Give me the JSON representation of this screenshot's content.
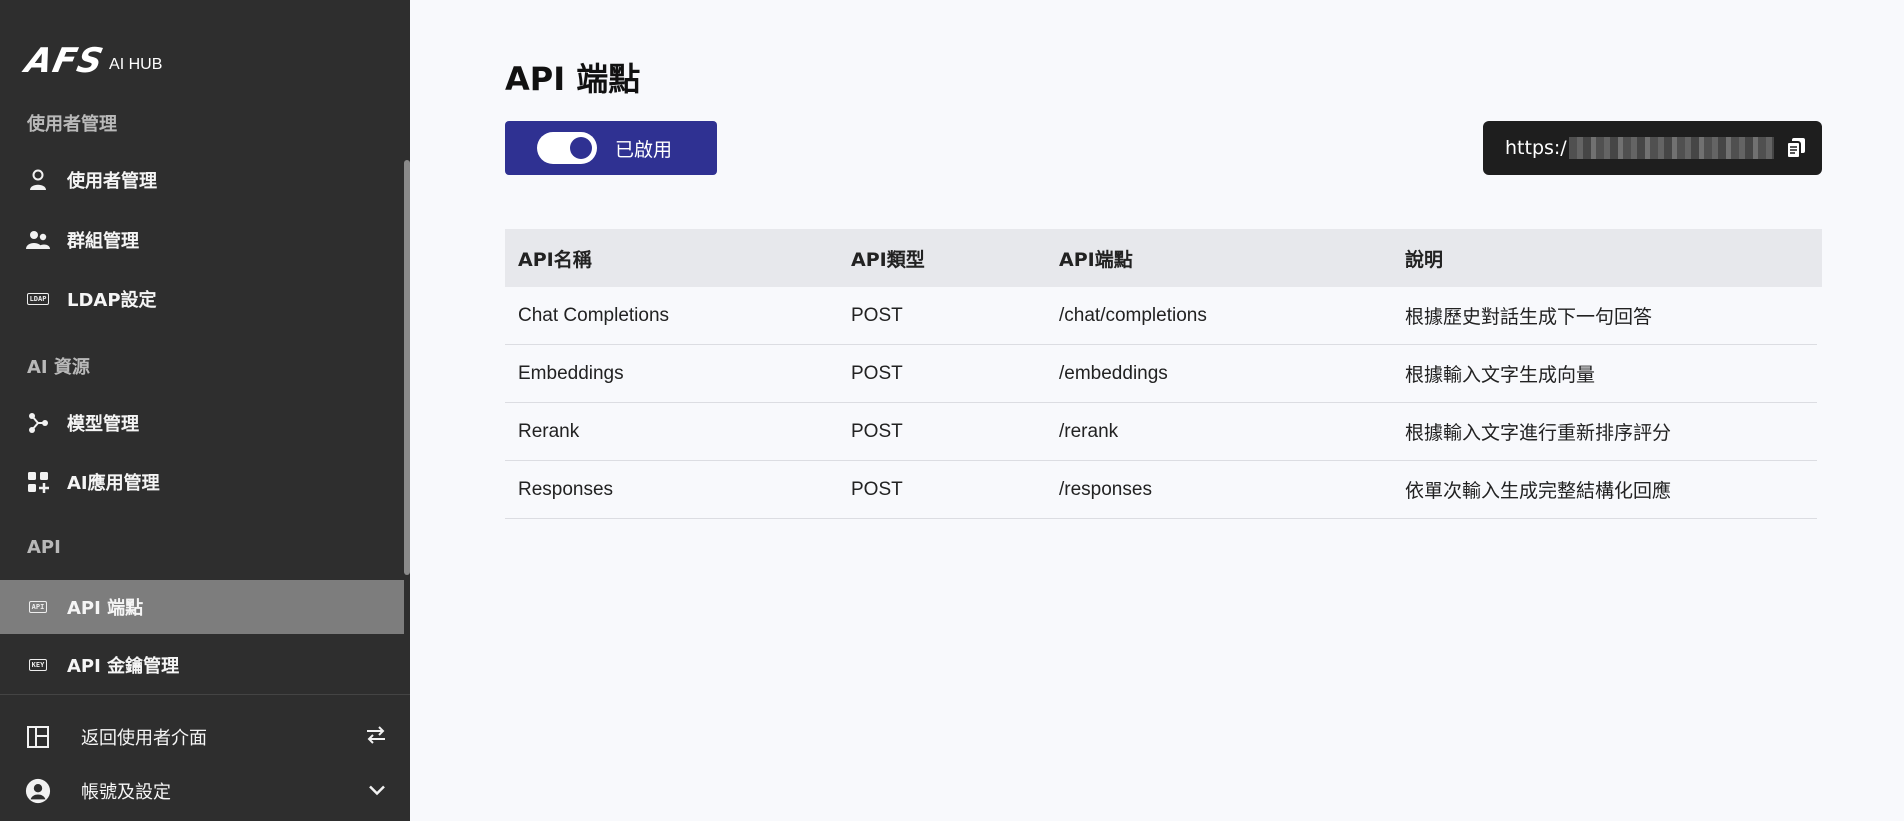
{
  "brand": {
    "mark": "AFS",
    "sub": "AI HUB"
  },
  "sidebar": {
    "sections": [
      {
        "label": "使用者管理"
      },
      {
        "label": "AI 資源"
      },
      {
        "label": "API"
      }
    ],
    "items": [
      {
        "label": "使用者管理",
        "icon": "user-icon"
      },
      {
        "label": "群組管理",
        "icon": "group-icon"
      },
      {
        "label": "LDAP設定",
        "icon": "ldap-icon",
        "badge": "LDAP"
      },
      {
        "label": "模型管理",
        "icon": "model-icon"
      },
      {
        "label": "AI應用管理",
        "icon": "apps-icon"
      },
      {
        "label": "API 端點",
        "icon": "api-icon",
        "badge": "API"
      },
      {
        "label": "API 金鑰管理",
        "icon": "key-icon",
        "badge": "KEY"
      }
    ],
    "bottom": [
      {
        "label": "返回使用者介面",
        "icon": "layout-icon",
        "right_icon": "swap-icon"
      },
      {
        "label": "帳號及設定",
        "icon": "account-icon",
        "right_icon": "chevron-down-icon"
      }
    ]
  },
  "main": {
    "title": "API 端點",
    "toggle": {
      "label": "已啟用",
      "enabled": true
    },
    "endpoint_url": {
      "visible_prefix": "https:/"
    },
    "table": {
      "headers": [
        "API名稱",
        "API類型",
        "API端點",
        "說明"
      ],
      "rows": [
        [
          "Chat Completions",
          "POST",
          "/chat/completions",
          "根據歷史對話生成下一句回答"
        ],
        [
          "Embeddings",
          "POST",
          "/embeddings",
          "根據輸入文字生成向量"
        ],
        [
          "Rerank",
          "POST",
          "/rerank",
          "根據輸入文字進行重新排序評分"
        ],
        [
          "Responses",
          "POST",
          "/responses",
          "依單次輸入生成完整結構化回應"
        ]
      ]
    }
  },
  "colors": {
    "sidebar_bg": "#2e2e2e",
    "active_item_bg": "#7d7d7d",
    "accent": "#2f3192",
    "url_box_bg": "#1e1e1e",
    "table_header_bg": "#e7e8ec"
  }
}
